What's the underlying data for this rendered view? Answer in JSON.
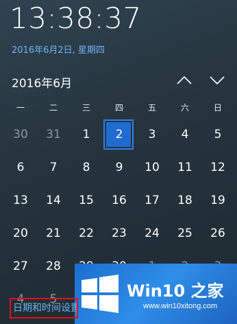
{
  "clock": {
    "time": "13:38:37"
  },
  "date_link": "2016年6月2日, 星期四",
  "calendar": {
    "month_label": "2016年6月",
    "weekdays": [
      "一",
      "二",
      "三",
      "四",
      "五",
      "六",
      "日"
    ],
    "days": [
      {
        "d": "30",
        "dim": true
      },
      {
        "d": "31",
        "dim": true
      },
      {
        "d": "1"
      },
      {
        "d": "2",
        "today": true
      },
      {
        "d": "3"
      },
      {
        "d": "4"
      },
      {
        "d": "5"
      },
      {
        "d": "6"
      },
      {
        "d": "7"
      },
      {
        "d": "8"
      },
      {
        "d": "9"
      },
      {
        "d": "10"
      },
      {
        "d": "11"
      },
      {
        "d": "12"
      },
      {
        "d": "13"
      },
      {
        "d": "14"
      },
      {
        "d": "15"
      },
      {
        "d": "16"
      },
      {
        "d": "17"
      },
      {
        "d": "18"
      },
      {
        "d": "19"
      },
      {
        "d": "20"
      },
      {
        "d": "21"
      },
      {
        "d": "22"
      },
      {
        "d": "23"
      },
      {
        "d": "24"
      },
      {
        "d": "25"
      },
      {
        "d": "26"
      },
      {
        "d": "27"
      },
      {
        "d": "28"
      },
      {
        "d": "29"
      },
      {
        "d": "30"
      },
      {
        "d": "1",
        "dim": true
      },
      {
        "d": "2",
        "dim": true
      },
      {
        "d": "3",
        "dim": true
      },
      {
        "d": "4",
        "dim": true
      },
      {
        "d": "5",
        "dim": true
      }
    ]
  },
  "settings_link": "日期和时间设置",
  "watermark": {
    "brand": "Win10 之家",
    "site": "www.win10xitong.com"
  },
  "icons": {
    "prev_month": "chevron-up-icon",
    "next_month": "chevron-down-icon",
    "logo": "windows-logo-icon"
  },
  "colors": {
    "accent": "#1f6bcf",
    "link": "#6fb4ee",
    "highlight_border": "#e01010"
  }
}
